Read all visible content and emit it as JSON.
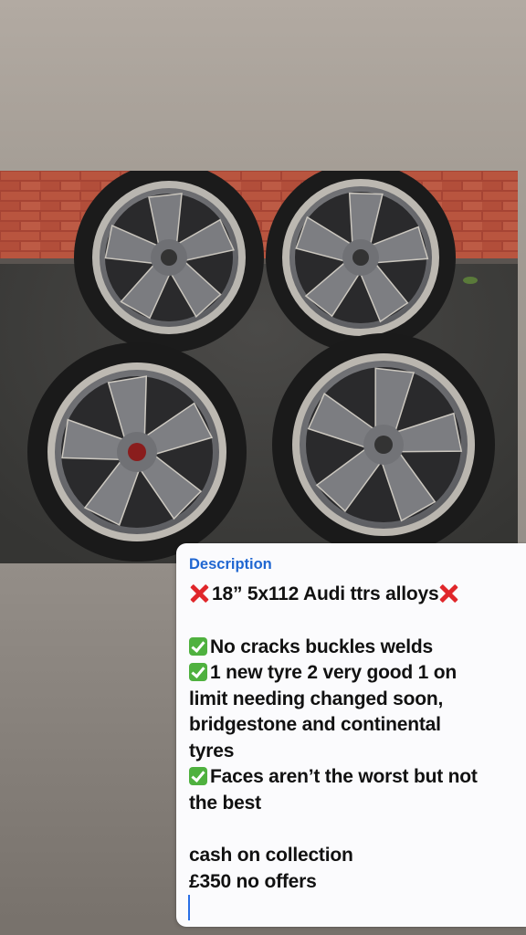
{
  "description_card": {
    "title": "Description",
    "headline": "18” 5x112 Audi ttrs alloys",
    "bullets": [
      "No cracks buckles welds",
      "1 new tyre 2 very good 1 on"
    ],
    "continuation_lines": [
      "limit needing changed soon,",
      "bridgestone and continental",
      "tyres"
    ],
    "bullet_3": "Faces aren’t the worst but not",
    "bullet_3_cont": "the best",
    "collection": "cash on collection",
    "price": "£350 no offers"
  },
  "icons": {
    "headline_marks": "cross-mark-icon",
    "bullet_marks": "check-mark-icon"
  },
  "colors": {
    "title_blue": "#1f66d1",
    "check_green": "#4fb13f",
    "cross_red": "#e0262a",
    "cursor_blue": "#2a6fe6"
  }
}
